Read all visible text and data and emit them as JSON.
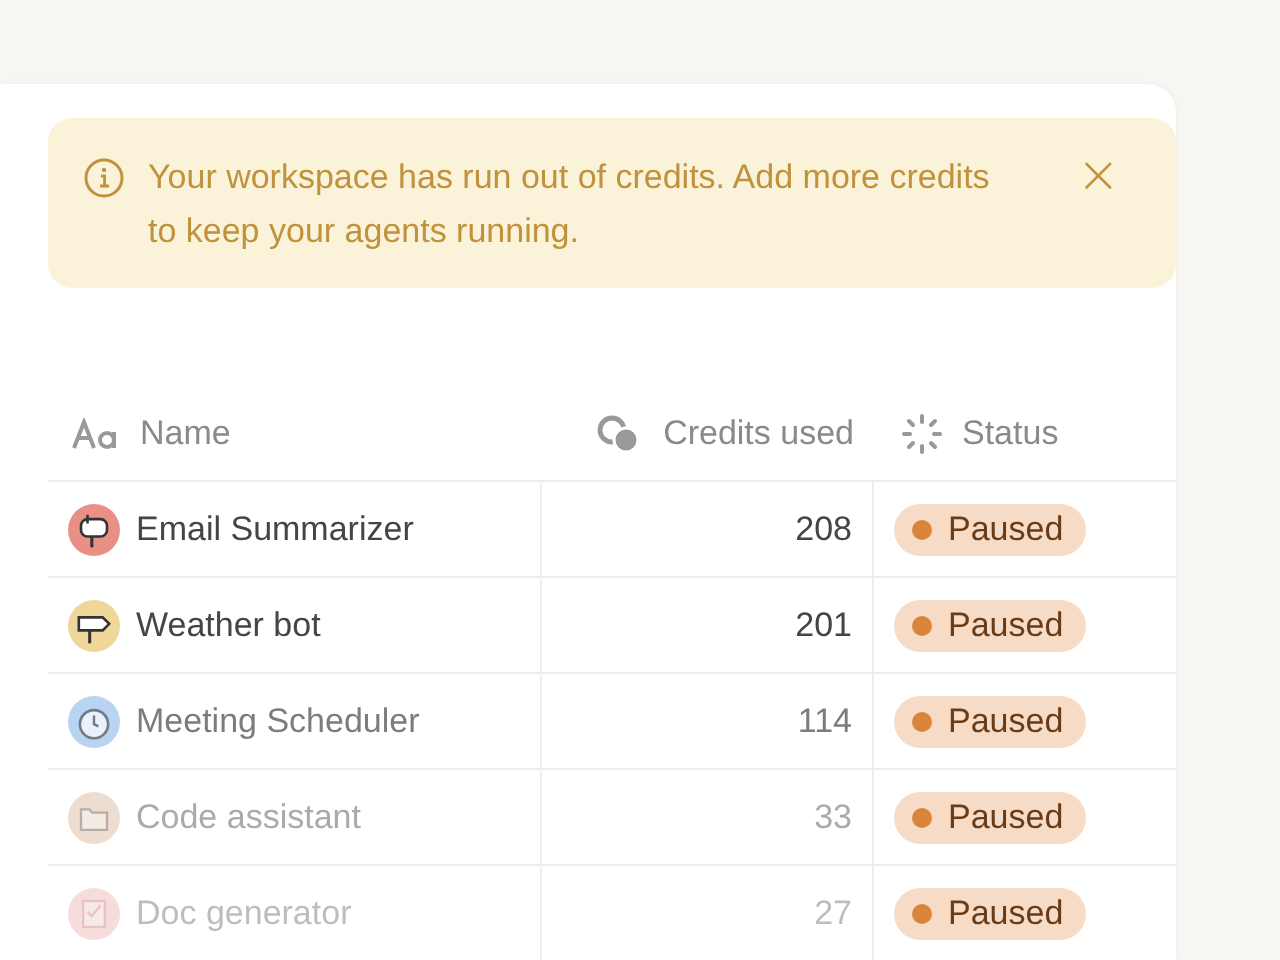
{
  "banner": {
    "message": "Your workspace has run out of credits. Add more credits to keep your agents running.",
    "close": "×"
  },
  "table": {
    "columns": [
      {
        "label": "Name",
        "kind": "text"
      },
      {
        "label": "Credits used",
        "kind": "credits"
      },
      {
        "label": "Status",
        "kind": "status"
      }
    ],
    "rows": [
      {
        "name": "Email Summarizer",
        "kind": "mailbox",
        "color": "#e98f86",
        "credits": "208",
        "status": "Paused"
      },
      {
        "name": "Weather bot",
        "kind": "signpost",
        "color": "#efd79a",
        "credits": "201",
        "status": "Paused"
      },
      {
        "name": "Meeting Scheduler",
        "kind": "clock",
        "color": "#b8d4f2",
        "credits": "114",
        "status": "Paused"
      },
      {
        "name": "Code assistant",
        "kind": "folder",
        "color": "#eddcd0",
        "credits": "33",
        "status": "Paused"
      },
      {
        "name": "Doc generator",
        "kind": "checklist",
        "color": "#f7dcdc",
        "credits": "27",
        "status": "Paused"
      }
    ]
  }
}
